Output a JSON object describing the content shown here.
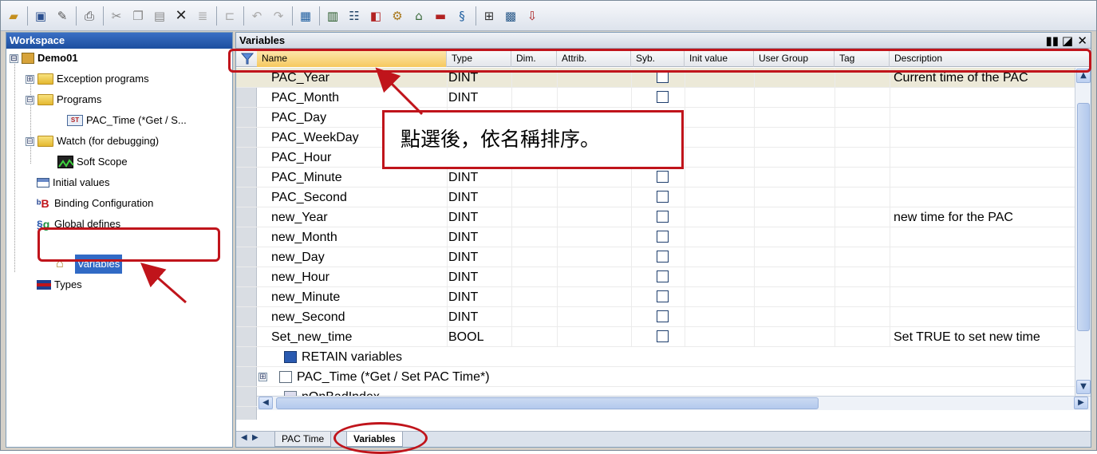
{
  "toolbar": {
    "icons": [
      "open-icon",
      "save-icon",
      "edit-icon",
      "print-icon",
      "cut-icon",
      "copy-icon",
      "paste-icon",
      "delete-icon",
      "replace-icon",
      "insert-icon",
      "undo-icon",
      "redo-icon",
      "compile-icon",
      "grid-icon",
      "network-icon",
      "binding-icon",
      "gear-icon",
      "home-icon",
      "types-icon",
      "global-defines-icon",
      "layout-icon",
      "project-icon",
      "download-icon"
    ]
  },
  "workspace": {
    "title": "Workspace",
    "tree": [
      {
        "label": "Demo01",
        "expander": "⊟"
      },
      {
        "label": "Exception programs",
        "expander": "⊞"
      },
      {
        "label": "Programs",
        "expander": "⊟"
      },
      {
        "label": "PAC_Time (*Get / S...",
        "icon": "ST"
      },
      {
        "label": "Watch (for debugging)",
        "expander": "⊟"
      },
      {
        "label": "Soft Scope"
      },
      {
        "label": "Initial values"
      },
      {
        "label": "Binding Configuration"
      },
      {
        "label": "Global defines"
      },
      {
        "label": "Variables"
      },
      {
        "label": "Types"
      }
    ]
  },
  "variables_pane": {
    "title": "Variables",
    "controls": [
      "▮▮",
      "◪",
      "✕"
    ],
    "columns": [
      "Name",
      "Type",
      "Dim.",
      "Attrib.",
      "Syb.",
      "Init value",
      "User Group",
      "Tag",
      "Description"
    ],
    "rows": [
      {
        "name": "PAC_Year",
        "type": "DINT",
        "description": "Current time of the PAC"
      },
      {
        "name": "PAC_Month",
        "type": "DINT",
        "description": ""
      },
      {
        "name": "PAC_Day",
        "type": "",
        "description": ""
      },
      {
        "name": "PAC_WeekDay",
        "type": "",
        "description": ""
      },
      {
        "name": "PAC_Hour",
        "type": "",
        "description": ""
      },
      {
        "name": "PAC_Minute",
        "type": "DINT",
        "description": ""
      },
      {
        "name": "PAC_Second",
        "type": "DINT",
        "description": ""
      },
      {
        "name": "new_Year",
        "type": "DINT",
        "description": "new time for the PAC"
      },
      {
        "name": "new_Month",
        "type": "DINT",
        "description": ""
      },
      {
        "name": "new_Day",
        "type": "DINT",
        "description": ""
      },
      {
        "name": "new_Hour",
        "type": "DINT",
        "description": ""
      },
      {
        "name": "new_Minute",
        "type": "DINT",
        "description": ""
      },
      {
        "name": "new_Second",
        "type": "DINT",
        "description": ""
      },
      {
        "name": "Set_new_time",
        "type": "BOOL",
        "description": "Set TRUE to set new time"
      }
    ],
    "groups": [
      {
        "label": "RETAIN variables"
      },
      {
        "label": "PAC_Time (*Get / Set PAC Time*)",
        "expander": "⊞"
      },
      {
        "label": "nOnBadIndex"
      }
    ],
    "tabs": [
      "PAC Time",
      "Variables"
    ],
    "tab_nav": [
      "◀",
      "▶"
    ]
  },
  "annotation": {
    "callout_text": "點選後，依名稱排序。"
  },
  "colors": {
    "accent_red": "#c0141b",
    "header_blue": "#1d4f9f",
    "selection_blue": "#316ac5"
  }
}
